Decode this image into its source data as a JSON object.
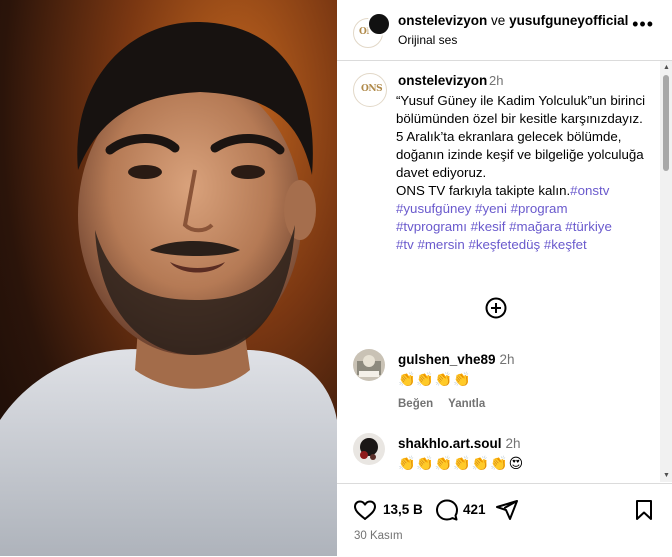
{
  "header": {
    "author": "onstelevizyon",
    "connector": "ve",
    "collaborator": "yusufguneyofficial",
    "audio": "Orijinal ses",
    "logo_text": "ONS"
  },
  "caption": {
    "username": "onstelevizyon",
    "time": "2h",
    "text": "“Yusuf Güney ile Kadim Yolculuk”un birinci bölümünden özel bir kesitle karşınızdayız.\n5 Aralık’ta ekranlara gelecek bölümde, doğanın izinde keşif ve bilgeliğe yolculuğa davet ediyoruz.\nONS TV farkıyla takipte kalın.",
    "hashtags": [
      "#onstv",
      "#yusufgüney",
      "#yeni",
      "#program",
      "#tvprogramı",
      "#kesif",
      "#mağara",
      "#türkiye",
      "#tv",
      "#mersin",
      "#keşfetedüş",
      "#keşfet"
    ]
  },
  "comments": [
    {
      "username": "gulshen_vhe89",
      "time": "2h",
      "text": "👏👏👏👏",
      "like_label": "Beğen",
      "reply_label": "Yanıtla"
    },
    {
      "username": "shakhlo.art.soul",
      "time": "2h",
      "text": "👏👏👏👏👏👏😍"
    }
  ],
  "footer": {
    "likes": "13,5 B",
    "comments": "421",
    "date": "30 Kasım"
  }
}
